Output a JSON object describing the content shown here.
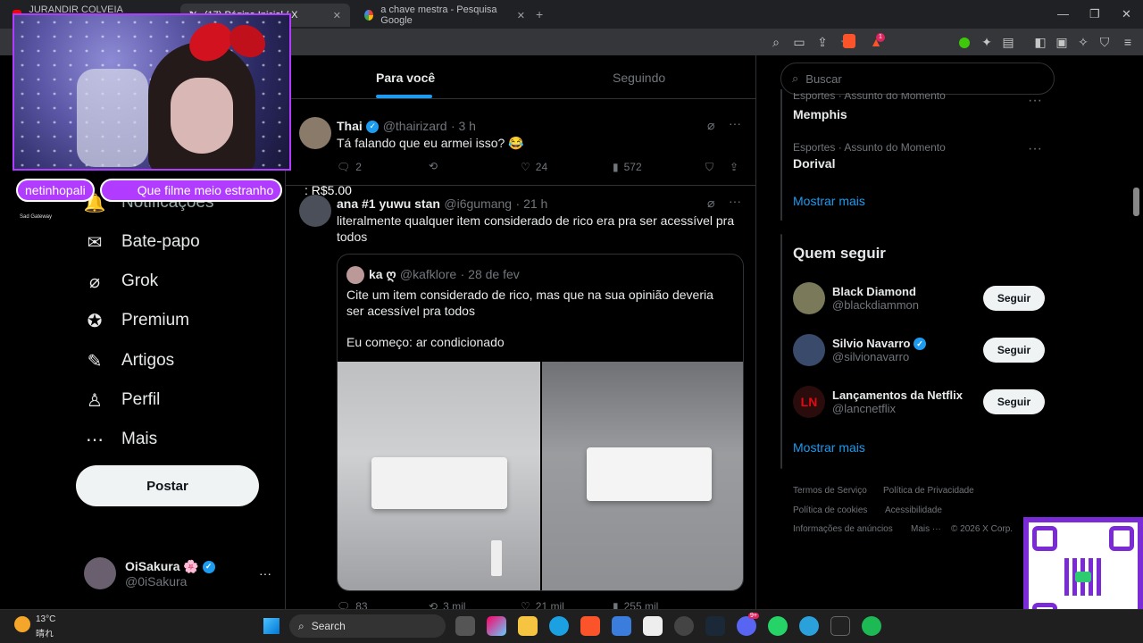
{
  "browser": {
    "tabs": [
      {
        "label": "JURANDIR COLVEIA LACROUZ - Yo"
      },
      {
        "label": "(17) Página Inicial / X"
      },
      {
        "label": "a chave mestra - Pesquisa Google"
      }
    ],
    "new_tab": "+",
    "badge_count": "1"
  },
  "stream": {
    "donation_name": "netinhopali",
    "donation_message": "Que filme meio estranho",
    "donation_amount": ": R$5.00",
    "small_tag": "Sad Gateway"
  },
  "nav": {
    "items": [
      {
        "label": "Notificações"
      },
      {
        "label": "Bate-papo"
      },
      {
        "label": "Grok"
      },
      {
        "label": "Premium"
      },
      {
        "label": "Artigos"
      },
      {
        "label": "Perfil"
      },
      {
        "label": "Mais"
      }
    ],
    "post_label": "Postar",
    "profile_name": "OiSakura",
    "profile_flower": "🌸",
    "profile_handle": "@0iSakura",
    "profile_more": "···"
  },
  "feed": {
    "tabs": [
      "Para você",
      "Seguindo"
    ],
    "tweets": [
      {
        "name": "Thai",
        "handle": "@thairizard",
        "time": "· 3 h",
        "text": "Tá falando que eu armei isso? 😂",
        "replies": "2",
        "likes": "24",
        "views": "572"
      },
      {
        "name": "ana #1 yuwu stan",
        "handle": "@i6gumang",
        "time": "· 21 h",
        "text": "literalmente qualquer item considerado de rico era pra ser acessível pra todos",
        "replies": "83",
        "retweets": "3 mil",
        "likes": "21 mil",
        "views": "255 mil",
        "quote": {
          "name": "ka ღ",
          "handle": "@kafklore",
          "time": "· 28 de fev",
          "text1": "Cite um item considerado de rico, mas que na sua opinião deveria ser acessível pra todos",
          "text2": "Eu começo: ar condicionado"
        }
      }
    ]
  },
  "sidebar": {
    "search_placeholder": "Buscar",
    "trends": [
      {
        "category": "Esportes · Assunto do Momento",
        "name": "Memphis"
      },
      {
        "category": "Esportes · Assunto do Momento",
        "name": "Dorival"
      }
    ],
    "trends_more": "Mostrar mais",
    "follow_title": "Quem seguir",
    "follow": [
      {
        "name": "Black Diamond",
        "handle": "@blackdiammon",
        "button": "Seguir"
      },
      {
        "name": "Silvio Navarro",
        "handle": "@silvionavarro",
        "button": "Seguir"
      },
      {
        "name": "Lançamentos da Netflix",
        "handle": "@lancnetflix",
        "button": "Seguir",
        "avatar_text": "LN"
      }
    ],
    "follow_more": "Mostrar mais",
    "footer": [
      "Termos de Serviço",
      "Política de Privacidade",
      "Política de cookies",
      "Acessibilidade",
      "Informações de anúncios",
      "Mais ···",
      "© 2026 X Corp."
    ]
  },
  "taskbar": {
    "weather_temp": "13°C",
    "weather_desc": "晴れ",
    "search": "Search",
    "badge_discord": "9+"
  },
  "colors": {
    "accent": "#1d9bf0",
    "stream": "#b13cff"
  }
}
